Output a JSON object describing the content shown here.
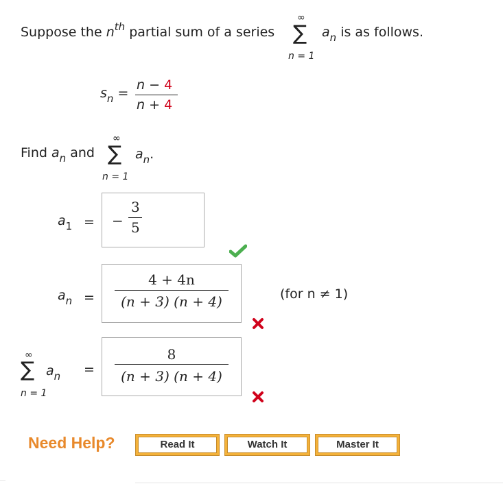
{
  "intro": {
    "text_before": "Suppose the",
    "n": "n",
    "th": "th",
    "text_middle": "partial sum of a series",
    "sigma": "∑",
    "sum_upper": "∞",
    "sum_lower": "n = 1",
    "term": "a",
    "term_sub": "n",
    "text_after": "is as follows."
  },
  "partial_sum": {
    "lhs": "s",
    "lhs_sub": "n",
    "equals": "=",
    "num_var": "n",
    "num_op": "−",
    "num_const": "4",
    "den_var": "n",
    "den_op": "+",
    "den_const": "4"
  },
  "find": {
    "text": "Find",
    "a": "a",
    "a_sub": "n",
    "and": "and",
    "sigma": "∑",
    "sum_upper": "∞",
    "sum_lower": "n = 1",
    "term": "a",
    "term_sub": "n",
    "period": "."
  },
  "answers": {
    "a1": {
      "label": "a",
      "label_sub": "1",
      "equals": "=",
      "sign": "−",
      "num": "3",
      "den": "5",
      "status": "correct"
    },
    "an": {
      "label": "a",
      "label_sub": "n",
      "equals": "=",
      "num": "4 + 4n",
      "den": "(n + 3) (n + 4)",
      "note": "(for n ≠ 1)",
      "status": "incorrect"
    },
    "sum": {
      "sigma": "∑",
      "sum_upper": "∞",
      "sum_lower": "n = 1",
      "label": "a",
      "label_sub": "n",
      "equals": "=",
      "num": "8",
      "den": "(n + 3) (n + 4)",
      "status": "incorrect"
    }
  },
  "help": {
    "label": "Need Help?",
    "buttons": [
      "Read It",
      "Watch It",
      "Master It"
    ]
  },
  "colors": {
    "correct": "#4caf50",
    "incorrect": "#d0021b",
    "help_orange": "#e8892b",
    "button_border": "#f4b23a"
  }
}
